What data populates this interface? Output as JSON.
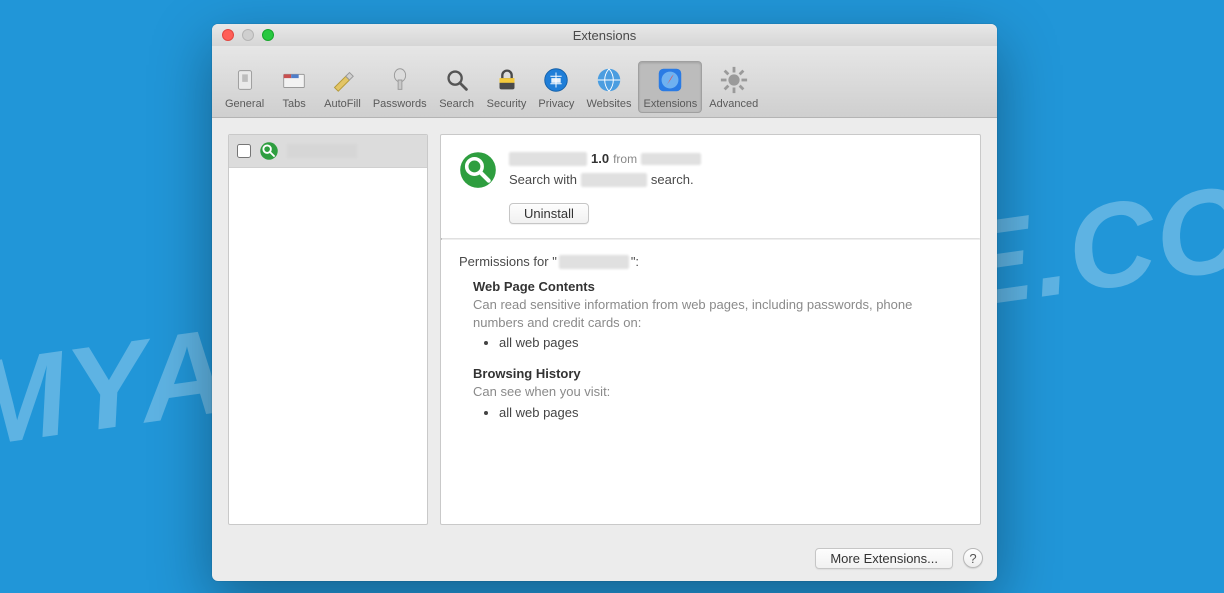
{
  "watermark": "MYANTISPYWARE.COM",
  "window": {
    "title": "Extensions"
  },
  "toolbar": {
    "items": [
      {
        "label": "General"
      },
      {
        "label": "Tabs"
      },
      {
        "label": "AutoFill"
      },
      {
        "label": "Passwords"
      },
      {
        "label": "Search"
      },
      {
        "label": "Security"
      },
      {
        "label": "Privacy"
      },
      {
        "label": "Websites"
      },
      {
        "label": "Extensions",
        "active": true
      },
      {
        "label": "Advanced"
      }
    ]
  },
  "sidebar": {
    "items": [
      {
        "name_redacted": true,
        "checked": false
      }
    ]
  },
  "detail": {
    "name_redacted": true,
    "version": "1.0",
    "from_label": "from",
    "developer_redacted": true,
    "description_prefix": "Search with",
    "description_suffix": "search.",
    "uninstall_label": "Uninstall",
    "permissions_prefix": "Permissions for \"",
    "permissions_suffix": "\":",
    "sections": [
      {
        "title": "Web Page Contents",
        "desc": "Can read sensitive information from web pages, including passwords, phone numbers and credit cards on:",
        "list": [
          "all web pages"
        ]
      },
      {
        "title": "Browsing History",
        "desc": "Can see when you visit:",
        "list": [
          "all web pages"
        ]
      }
    ]
  },
  "footer": {
    "more_label": "More Extensions...",
    "help": "?"
  },
  "colors": {
    "accent_green": "#2e9e3f"
  }
}
